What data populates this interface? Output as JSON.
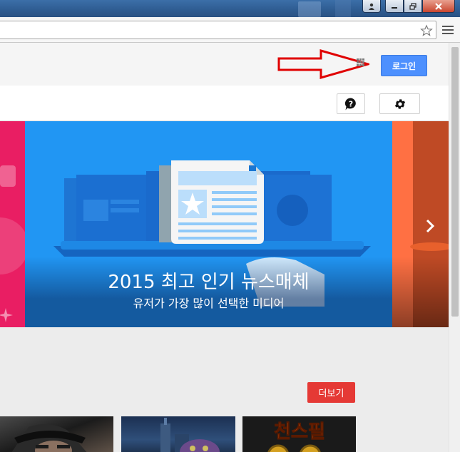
{
  "browser": {
    "address_value": "",
    "bookmark_icon": "star-icon",
    "menu_icon": "hamburger-icon"
  },
  "header": {
    "login_label": "로그인"
  },
  "toolbar": {
    "help_icon": "question-icon",
    "settings_icon": "gear-icon"
  },
  "carousel": {
    "title": "2015 최고 인기 뉴스매체",
    "subtitle": "유저가 가장 많이 선택한 미디어",
    "next_icon": "chevron-right-icon"
  },
  "section": {
    "more_label": "더보기",
    "thumb3_text": "천스필"
  },
  "colors": {
    "login_blue": "#4d90fe",
    "slide_blue": "#2196f3",
    "slide_pink": "#e91e63",
    "more_red": "#e53935",
    "annotation_arrow_red": "#e00000"
  }
}
